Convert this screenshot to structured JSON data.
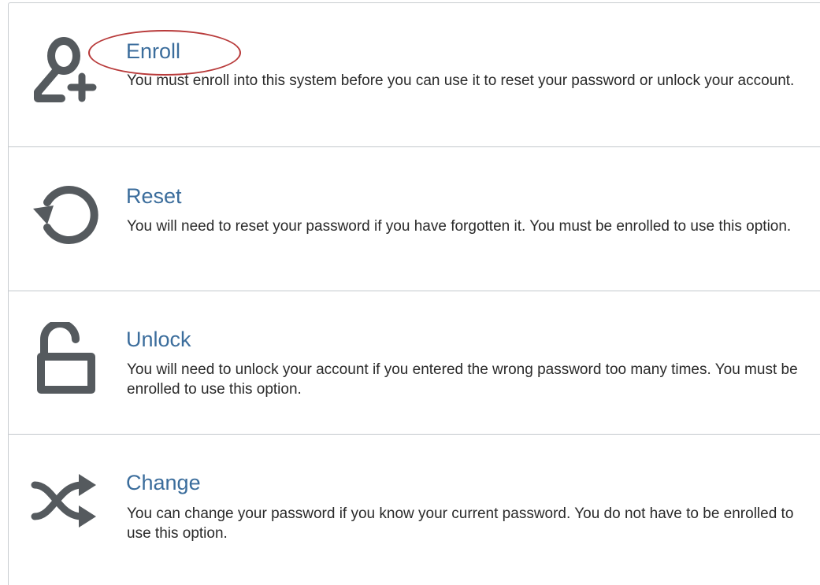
{
  "options": [
    {
      "id": "enroll",
      "icon": "user-plus-icon",
      "title": "Enroll",
      "description": "You must enroll into this system before you can use it to reset your password or unlock your account."
    },
    {
      "id": "reset",
      "icon": "reset-icon",
      "title": "Reset",
      "description": "You will need to reset your password if you have forgotten it. You must be enrolled to use this option."
    },
    {
      "id": "unlock",
      "icon": "unlock-icon",
      "title": "Unlock",
      "description": "You will need to unlock your account if you entered the wrong password too many times. You must be enrolled to use this option."
    },
    {
      "id": "change",
      "icon": "shuffle-icon",
      "title": "Change",
      "description": "You can change your password if you know your current password. You do not have to be enrolled to use this option."
    }
  ],
  "colors": {
    "title": "#3b6d9c",
    "icon": "#555a5e",
    "annotation": "#b83a3a",
    "divider": "#c3c8cc"
  }
}
